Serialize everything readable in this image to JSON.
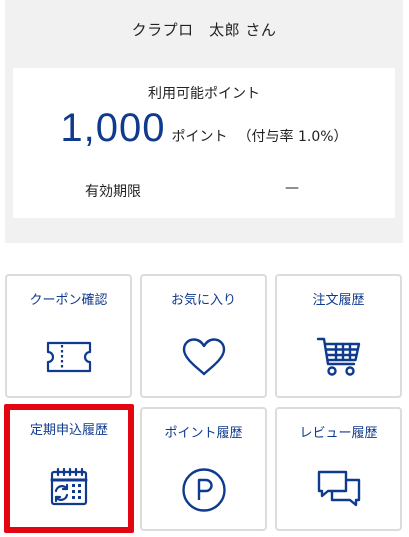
{
  "member": {
    "name": "クラプロ　太郎 さん"
  },
  "points": {
    "label": "利用可能ポイント",
    "value": "1,000",
    "unit": "ポイント",
    "rate": "（付与率 1.0%）",
    "expiry_label": "有効期限",
    "expiry_value": "—"
  },
  "menu": {
    "tiles": [
      {
        "label": "クーポン確認",
        "icon": "coupon-icon"
      },
      {
        "label": "お気に入り",
        "icon": "heart-icon"
      },
      {
        "label": "注文履歴",
        "icon": "cart-icon"
      },
      {
        "label": "定期申込履歴",
        "icon": "calendar-repeat-icon",
        "highlighted": true
      },
      {
        "label": "ポイント履歴",
        "icon": "point-p-icon"
      },
      {
        "label": "レビュー履歴",
        "icon": "chat-bubbles-icon"
      }
    ]
  },
  "colors": {
    "accent": "#0f3a8e",
    "highlight_border": "#e30612",
    "panel_bg": "#f1f1f1",
    "tile_border": "#dcdcdc"
  }
}
